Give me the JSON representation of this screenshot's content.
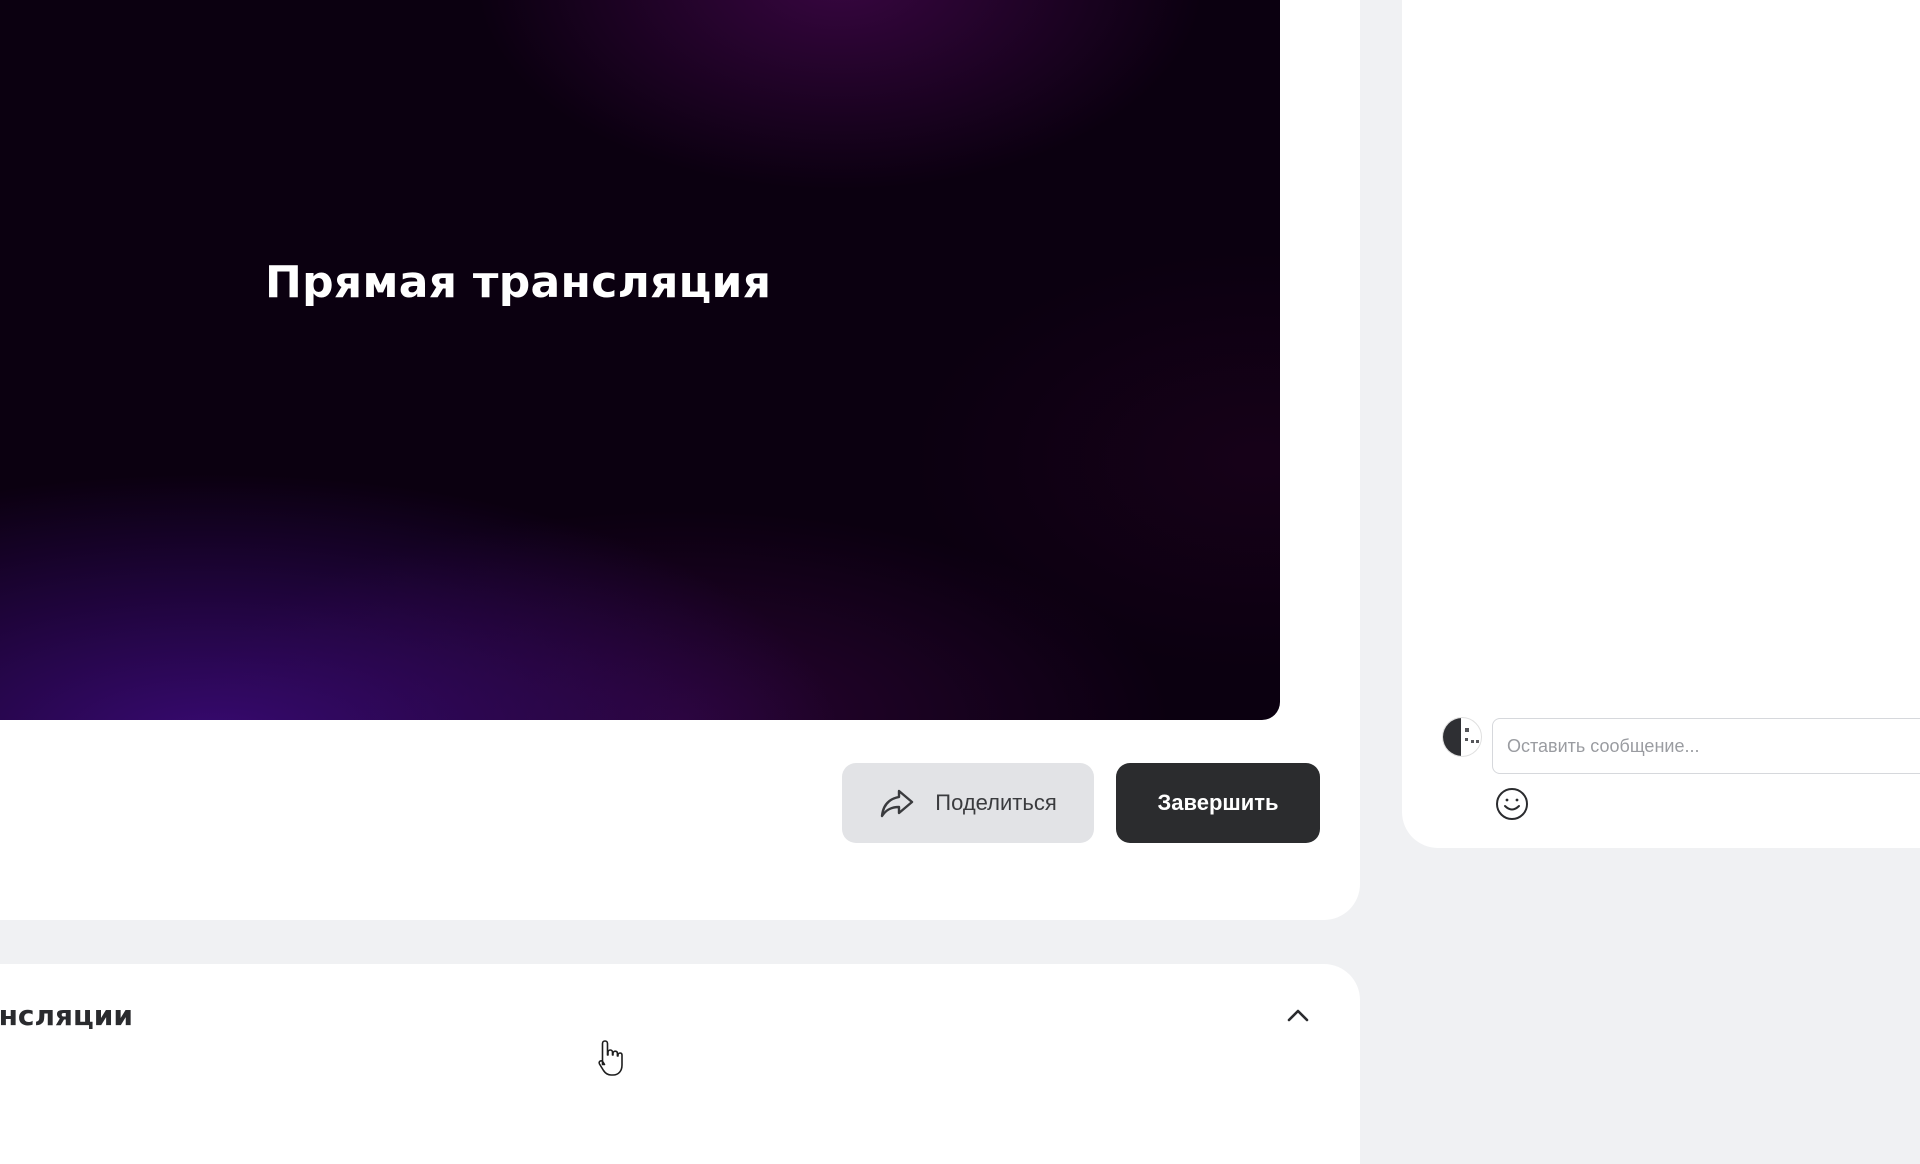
{
  "player": {
    "title": "Прямая трансляция"
  },
  "actions": {
    "share_label": "Поделиться",
    "finish_label": "Завершить"
  },
  "chat": {
    "input_placeholder": "Оставить сообщение..."
  },
  "section": {
    "title": "Настройки трансляции",
    "expanded": true
  },
  "colors": {
    "page_background": "#f0f1f3",
    "card_background": "#ffffff",
    "player_background": "#0b0010",
    "player_accent": "#3a0a76",
    "share_button": "#e2e3e6",
    "finish_button": "#2b2c2e"
  },
  "icons": {
    "share": "share-arrow-icon",
    "emoji": "smiley-icon",
    "collapse": "chevron-up-icon",
    "cursor": "hand-pointer-icon"
  }
}
